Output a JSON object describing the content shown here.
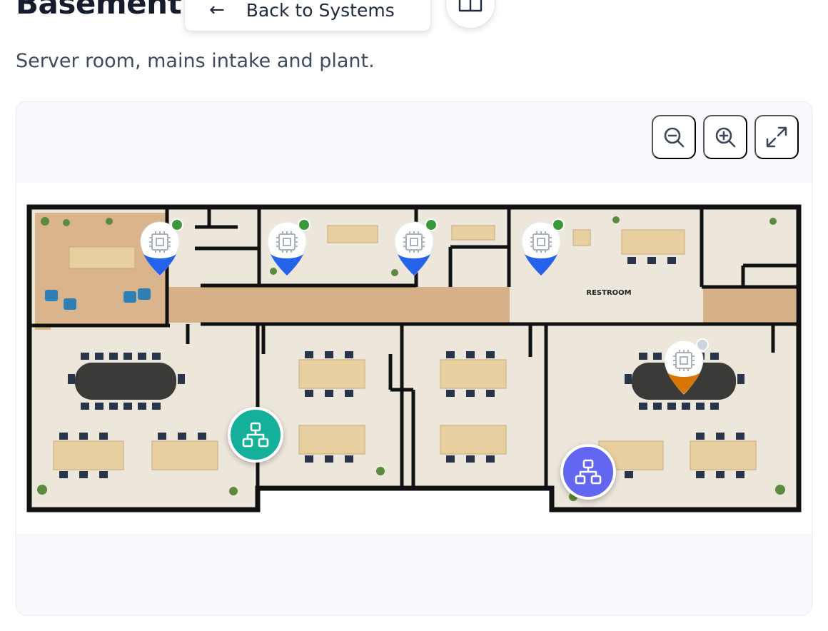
{
  "header": {
    "title": "Basement",
    "back_label": "Back to Systems",
    "subtitle": "Server room, mains intake and plant."
  },
  "icons": {
    "back": "arrow-left-icon",
    "guide": "book-open-icon",
    "zoom_out": "zoom-out-icon",
    "zoom_in": "zoom-in-icon",
    "fullscreen": "expand-icon",
    "device": "cpu-chip-icon",
    "system": "network-hierarchy-icon"
  },
  "floor_labels": {
    "restroom": "RESTROOM"
  },
  "devices": [
    {
      "id": "d1",
      "status": "online",
      "pin_color": "#2563eb",
      "status_color": "#3a9a3a"
    },
    {
      "id": "d2",
      "status": "online",
      "pin_color": "#2563eb",
      "status_color": "#3a9a3a"
    },
    {
      "id": "d3",
      "status": "online",
      "pin_color": "#2563eb",
      "status_color": "#3a9a3a"
    },
    {
      "id": "d4",
      "status": "online",
      "pin_color": "#2563eb",
      "status_color": "#3a9a3a"
    },
    {
      "id": "d5",
      "status": "unknown",
      "pin_color": "#d97706",
      "status_color": "#cfd5de"
    }
  ],
  "systems": [
    {
      "id": "s1",
      "color": "#14b09a"
    },
    {
      "id": "s2",
      "color": "#6366f1"
    }
  ],
  "colors": {
    "wall": "#111111",
    "floor": "#ece6db",
    "wood": "#d9b48c",
    "desk": "#e8cf9f"
  }
}
